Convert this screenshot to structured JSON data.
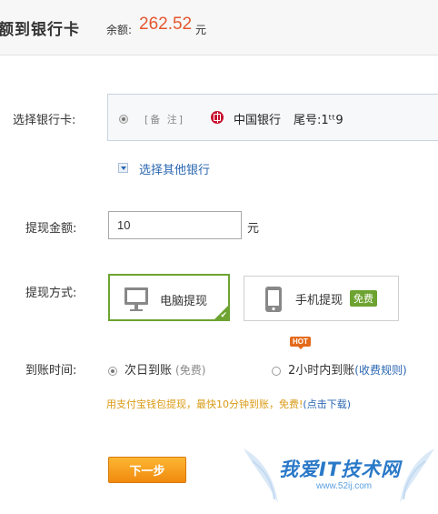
{
  "header": {
    "title": "额到银行卡",
    "balance_label": "余额:",
    "balance_amount": "262.52",
    "balance_unit": "元"
  },
  "bank_select": {
    "label": "选择银行卡:",
    "remark": "[备 注]",
    "bank_name": "中国银行",
    "tail_label": "尾号:1ᵗᵗ9",
    "other_bank_link": "选择其他银行"
  },
  "amount": {
    "label": "提现金额:",
    "value": "10",
    "unit": "元"
  },
  "method": {
    "label": "提现方式:",
    "pc_label": "电脑提现",
    "mobile_label": "手机提现",
    "free_badge": "免费",
    "selected": "pc"
  },
  "arrival": {
    "label": "到账时间:",
    "option1": "次日到账",
    "option1_sub": "(免费)",
    "hot_badge": "HOT",
    "option2": "2小时内到账",
    "option2_link": "(收费规则)",
    "selected": "option1"
  },
  "promo": {
    "text": "用支付宝钱包提现，最快10分钟到账，免费!",
    "link": "(点击下载)"
  },
  "next_button": "下一步",
  "watermark": {
    "title": "我爱IT技术网",
    "url": "www.52ij.com"
  },
  "colors": {
    "accent_green": "#6da331",
    "link_blue": "#2a66b0",
    "amount_red": "#e4572e",
    "button_orange": "#f5a020"
  }
}
